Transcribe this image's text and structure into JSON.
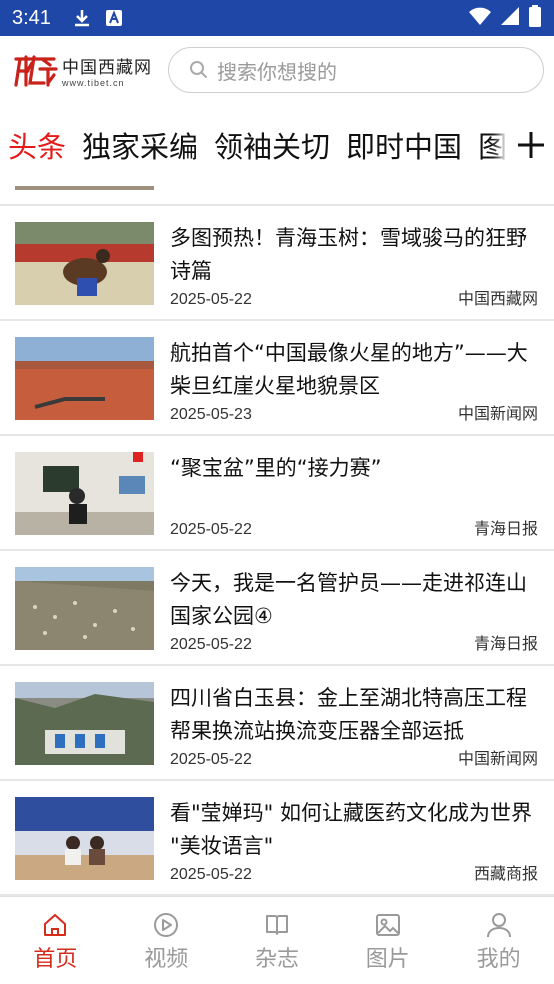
{
  "status_bar": {
    "time": "3:41"
  },
  "header": {
    "logo_cn": "中国西藏网",
    "logo_en": "www.tibet.cn",
    "search_placeholder": "搜索你想搜的"
  },
  "tabs": [
    {
      "label": "头条",
      "active": true
    },
    {
      "label": "独家采编"
    },
    {
      "label": "领袖关切"
    },
    {
      "label": "即时中国"
    },
    {
      "label": "图"
    }
  ],
  "articles": [
    {
      "title": "多图预热！青海玉树：雪域骏马的狂野诗篇",
      "date": "2025-05-22",
      "source": "中国西藏网",
      "thumb": "horse-race"
    },
    {
      "title": "航拍首个“中国最像火星的地方”——大柴旦红崖火星地貌景区",
      "date": "2025-05-23",
      "source": "中国新闻网",
      "thumb": "mars-landscape"
    },
    {
      "title": "“聚宝盆”里的“接力赛”",
      "date": "2025-05-22",
      "source": "青海日报",
      "thumb": "classroom"
    },
    {
      "title": "今天，我是一名管护员——走进祁连山国家公园④",
      "date": "2025-05-22",
      "source": "青海日报",
      "thumb": "hillside-herd"
    },
    {
      "title": "四川省白玉县：金上至湖北特高压工程帮果换流站换流变压器全部运抵",
      "date": "2025-05-22",
      "source": "中国新闻网",
      "thumb": "converter-station"
    },
    {
      "title": "看\"莹婵玛\" 如何让藏医药文化成为世界 \"美妆语言\"",
      "date": "2025-05-22",
      "source": "西藏商报",
      "thumb": "exhibition"
    }
  ],
  "bottom_nav": [
    {
      "label": "首页",
      "icon": "home-icon",
      "active": true
    },
    {
      "label": "视频",
      "icon": "play-icon"
    },
    {
      "label": "杂志",
      "icon": "book-icon"
    },
    {
      "label": "图片",
      "icon": "image-icon"
    },
    {
      "label": "我的",
      "icon": "user-icon"
    }
  ],
  "colors": {
    "status_bar": "#1f47a8",
    "accent": "#e51a1a",
    "nav_active": "#d42d1e",
    "nav_inactive": "#9a9a9a"
  }
}
